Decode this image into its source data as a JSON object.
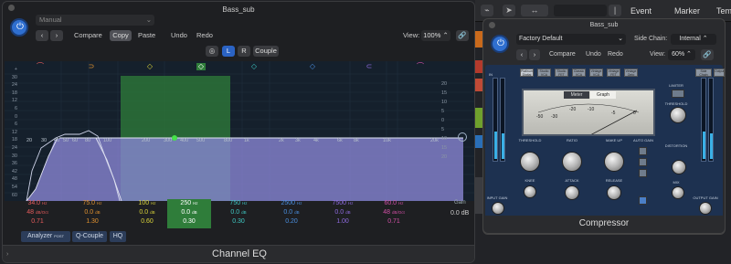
{
  "eq": {
    "title": "Bass_sub",
    "preset": "Manual",
    "toolbar": {
      "compare": "Compare",
      "copy": "Copy",
      "paste": "Paste",
      "undo": "Undo",
      "redo": "Redo",
      "view_label": "View:",
      "view_value": "100%"
    },
    "channel": {
      "l": "L",
      "r": "R",
      "couple": "Couple"
    },
    "db_left": [
      "+",
      "30",
      "24",
      "18",
      "12",
      "6",
      "0",
      "6",
      "12",
      "18",
      "24",
      "30",
      "36",
      "42",
      "48",
      "54",
      "60"
    ],
    "db_right": [
      "20",
      "15",
      "10",
      "5",
      "0",
      "5",
      "10",
      "15",
      "20"
    ],
    "freq_labels": [
      "20",
      "30",
      "40",
      "50",
      "60",
      "80",
      "100",
      "200",
      "300",
      "400",
      "500",
      "800",
      "1k",
      "2k",
      "3k",
      "4k",
      "6k",
      "8k",
      "10k",
      "20k"
    ],
    "bands": [
      {
        "freq": "34.0",
        "unit": "Hz",
        "gain": "48",
        "gain_unit": "dB/Oct",
        "q": "0.71",
        "color": "#e65b5b"
      },
      {
        "freq": "75.0",
        "unit": "Hz",
        "gain": "0.0",
        "gain_unit": "dB",
        "q": "1.30",
        "color": "#e0912f"
      },
      {
        "freq": "100",
        "unit": "Hz",
        "gain": "0.0",
        "gain_unit": "dB",
        "q": "0.60",
        "color": "#d8d23a"
      },
      {
        "freq": "250",
        "unit": "Hz",
        "gain": "0.0",
        "gain_unit": "dB",
        "q": "0.30",
        "color": "#5fcf5a"
      },
      {
        "freq": "750",
        "unit": "Hz",
        "gain": "0.0",
        "gain_unit": "dB",
        "q": "0.30",
        "color": "#3fc7c2"
      },
      {
        "freq": "2500",
        "unit": "Hz",
        "gain": "0.0",
        "gain_unit": "dB",
        "q": "0.20",
        "color": "#4a8fe0"
      },
      {
        "freq": "7500",
        "unit": "Hz",
        "gain": "0.0",
        "gain_unit": "dB",
        "q": "1.00",
        "color": "#8f6be0"
      },
      {
        "freq": "60.0",
        "unit": "Hz",
        "gain": "48",
        "gain_unit": "dB/Oct",
        "q": "0.71",
        "color": "#d24fa6"
      }
    ],
    "gain_label": "Gain",
    "gain_value": "0.0",
    "gain_unit": "dB",
    "analyzer": "Analyzer",
    "analyzer_mode": "POST",
    "q_couple": "Q-Couple",
    "hq": "HQ",
    "footer": "Channel EQ"
  },
  "comp": {
    "title": "Bass_sub",
    "preset": "Factory Default",
    "sidechain_label": "Side Chain:",
    "sidechain_value": "Internal",
    "compare": "Compare",
    "undo": "Undo",
    "redo": "Redo",
    "view_label": "View:",
    "view_value": "60%",
    "models": [
      "Platinum Digital",
      "Studio VCA",
      "Studio FET",
      "Classic VCA",
      "Vintage VCA",
      "Vintage FET",
      "Vintage Opto"
    ],
    "side_btns": [
      "Side Chain",
      "Output"
    ],
    "meter_tabs": [
      "Meter",
      "Graph"
    ],
    "vu_scale": [
      "-50",
      "-30",
      "-20",
      "-10",
      "-5",
      "0"
    ],
    "labels": {
      "input": "INPUT GAIN",
      "threshold": "THRESHOLD",
      "ratio": "RATIO",
      "makeup": "MAKE UP",
      "autogain": "AUTO GAIN",
      "knee": "KNEE",
      "attack": "ATTACK",
      "release": "RELEASE",
      "limiter": "LIMITER",
      "lim_thresh": "THRESHOLD",
      "distortion": "DISTORTION",
      "mix": "MIX",
      "output": "OUTPUT GAIN",
      "on": "ON",
      "off": "OFF"
    },
    "footer": "Compressor"
  },
  "daw": {
    "event": "Event",
    "marker": "Marker",
    "tempo": "Temp"
  }
}
